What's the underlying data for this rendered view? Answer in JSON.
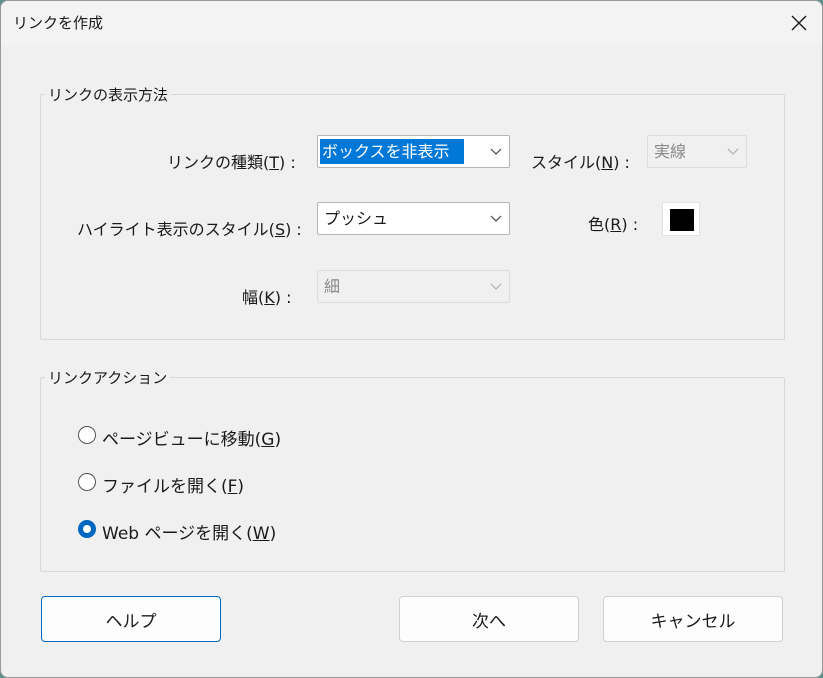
{
  "dialog": {
    "title": "リンクを作成"
  },
  "display_group": {
    "title": "リンクの表示方法",
    "link_type": {
      "label": "リンクの種類(",
      "mnemonic": "T",
      "suffix": ") :",
      "value": "ボックスを非表示"
    },
    "style": {
      "label": "スタイル(",
      "mnemonic": "N",
      "suffix": ") :",
      "value": "実線"
    },
    "highlight": {
      "label": "ハイライト表示のスタイル(",
      "mnemonic": "S",
      "suffix": ") :",
      "value": "プッシュ"
    },
    "color": {
      "label": "色(",
      "mnemonic": "R",
      "suffix": ") :",
      "value": "#000000"
    },
    "width": {
      "label": "幅(",
      "mnemonic": "K",
      "suffix": ") :",
      "value": "細"
    }
  },
  "action_group": {
    "title": "リンクアクション",
    "options": [
      {
        "label": "ページビューに移動(",
        "mnemonic": "G",
        "suffix": ")",
        "selected": false
      },
      {
        "label": "ファイルを開く(",
        "mnemonic": "F",
        "suffix": ")",
        "selected": false
      },
      {
        "label": "Web ページを開く(",
        "mnemonic": "W",
        "suffix": ")",
        "selected": true
      }
    ]
  },
  "buttons": {
    "help": "ヘルプ",
    "next": "次へ",
    "cancel": "キャンセル"
  },
  "colors": {
    "accent": "#0067c0",
    "selection": "#0078d7",
    "dialog_bg": "#f0f0f0"
  },
  "icons": {
    "close": "close-icon",
    "dropdown": "chevron-down-icon"
  }
}
